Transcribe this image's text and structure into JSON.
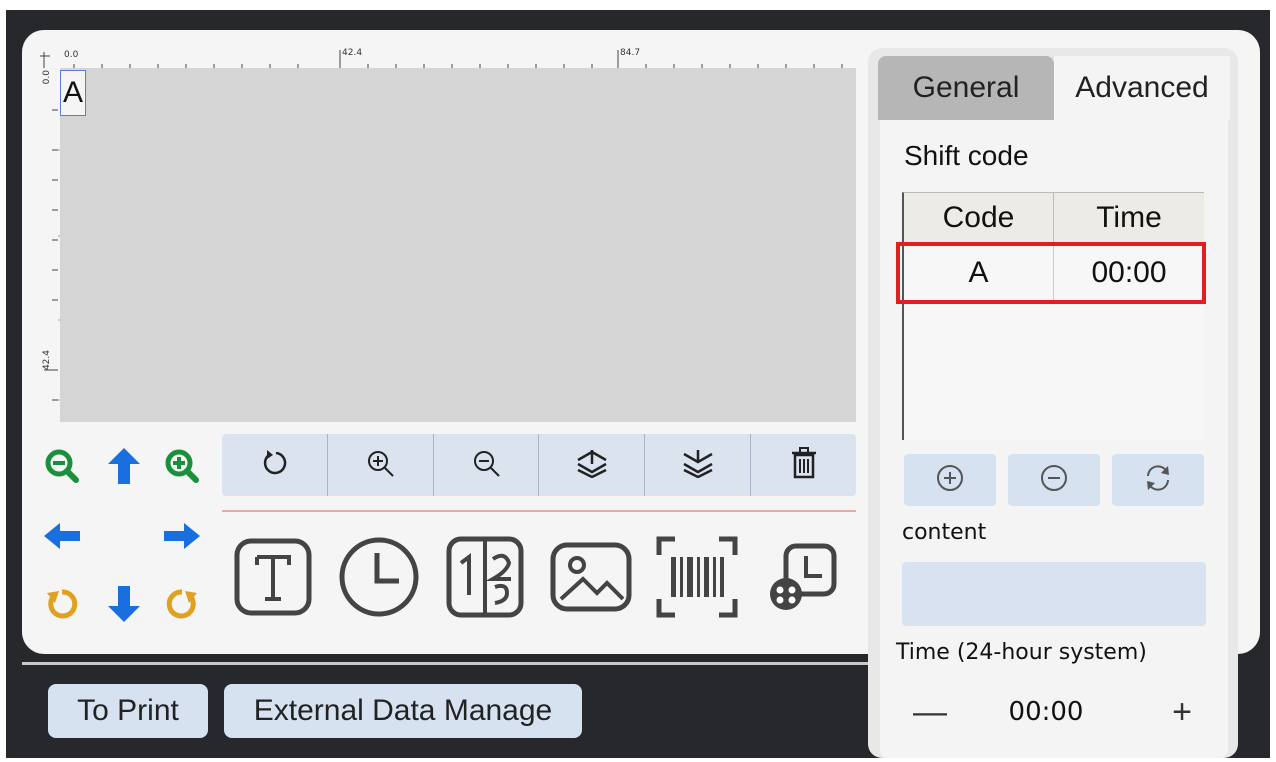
{
  "ruler": {
    "top_labels": [
      "0.0",
      "42.4",
      "84.7"
    ],
    "left_labels": [
      "0.0",
      "42.4"
    ]
  },
  "canvas": {
    "item_text": "A"
  },
  "colors": {
    "zoom_green": "#1a8f3c",
    "arrow_blue": "#1a6fe0",
    "rotate_orange": "#e0a020",
    "selection_red": "#e02020"
  },
  "pad": {
    "icons": [
      "zoom-out-icon",
      "arrow-up-icon",
      "zoom-in-icon",
      "arrow-left-icon",
      "arrow-right-icon",
      "rotate-left-icon",
      "arrow-down-icon",
      "rotate-right-icon"
    ]
  },
  "toolbar": {
    "icons": [
      "refresh-icon",
      "zoom-in-icon",
      "zoom-out-icon",
      "layer-up-icon",
      "layer-down-icon",
      "trash-icon"
    ]
  },
  "insert": {
    "icons": [
      "text-icon",
      "clock-icon",
      "counter-icon",
      "image-icon",
      "barcode-icon",
      "shift-time-icon"
    ]
  },
  "bottom": {
    "print_label": "To Print",
    "external_label": "External Data Manage"
  },
  "tabs": {
    "general": "General",
    "advanced": "Advanced"
  },
  "shift": {
    "title": "Shift code",
    "col_code": "Code",
    "col_time": "Time",
    "rows": [
      {
        "code": "A",
        "time": "00:00"
      }
    ]
  },
  "editor": {
    "content_label": "content",
    "content_value": "",
    "time_label": "Time (24-hour system)",
    "time_value": "00:00",
    "minus": "—",
    "plus": "+"
  }
}
